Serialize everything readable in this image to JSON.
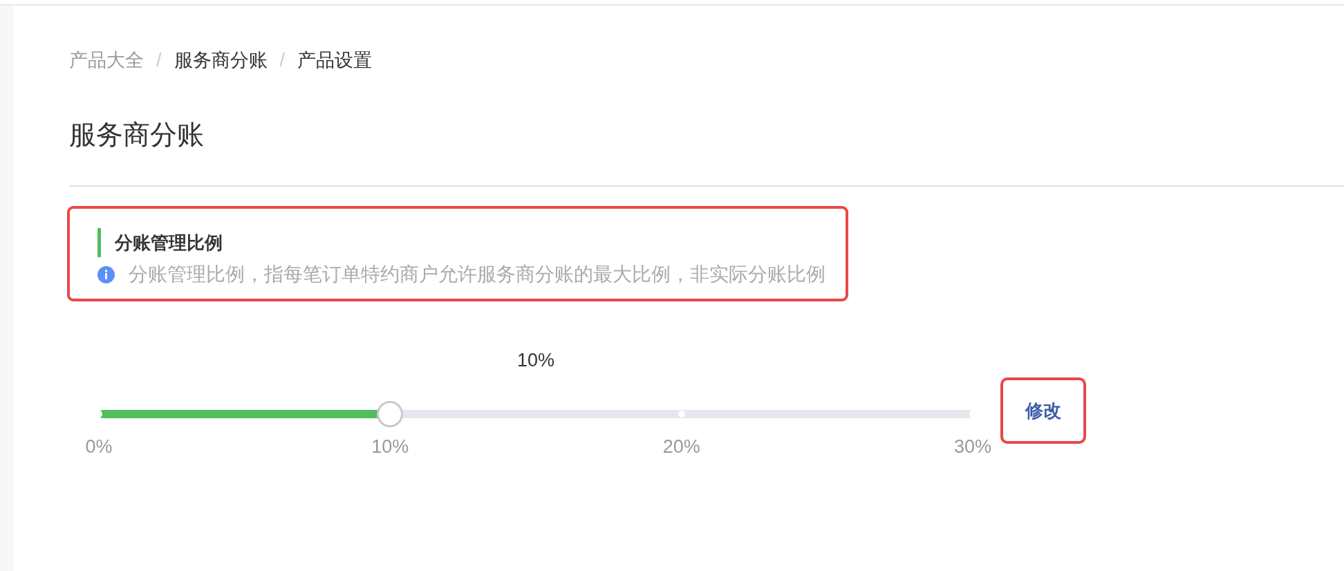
{
  "breadcrumb": {
    "items": [
      {
        "label": "产品大全",
        "kind": "link"
      },
      {
        "label": "服务商分账",
        "kind": "text"
      },
      {
        "label": "产品设置",
        "kind": "text"
      }
    ],
    "separators": [
      "/",
      "/"
    ]
  },
  "page_title": "服务商分账",
  "section": {
    "title": "分账管理比例",
    "info": "分账管理比例，指每笔订单特约商户允许服务商分账的最大比例，非实际分账比例",
    "highlighted": true
  },
  "slider": {
    "value_label": "10%",
    "level": 0.3333,
    "marks": [
      "0%",
      "10%",
      "20%",
      "30%"
    ]
  },
  "edit_button": {
    "label": "修改",
    "highlighted": true
  }
}
